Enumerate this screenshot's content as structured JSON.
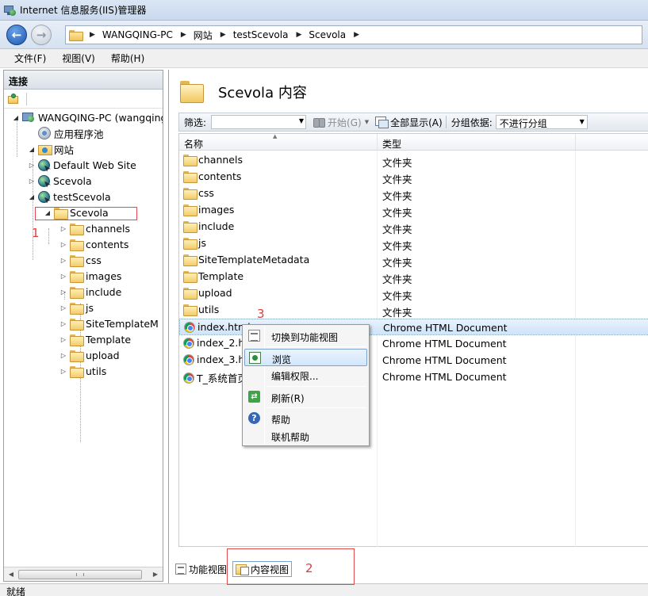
{
  "window": {
    "title": "Internet 信息服务(IIS)管理器"
  },
  "address": {
    "crumbs": [
      "WANGQING-PC",
      "网站",
      "testScevola",
      "Scevola"
    ]
  },
  "menu": {
    "items": [
      "文件(F)",
      "视图(V)",
      "帮助(H)"
    ]
  },
  "connections": {
    "header": "连接",
    "tree": [
      {
        "label": "WANGQING-PC (wangqing",
        "icon": "server-icon",
        "level": 0,
        "expander": "open"
      },
      {
        "label": "应用程序池",
        "icon": "app-pool-icon",
        "level": 1,
        "expander": "none"
      },
      {
        "label": "网站",
        "icon": "sites-icon",
        "level": 1,
        "expander": "open"
      },
      {
        "label": "Default Web Site",
        "icon": "globe-icon",
        "level": 2,
        "expander": "closed"
      },
      {
        "label": "Scevola",
        "icon": "globe-icon",
        "level": 2,
        "expander": "closed"
      },
      {
        "label": "testScevola",
        "icon": "globe-icon",
        "level": 2,
        "expander": "open"
      },
      {
        "label": "Scevola",
        "icon": "folder-icon",
        "level": 3,
        "expander": "open"
      },
      {
        "label": "channels",
        "icon": "folder-icon",
        "level": 4,
        "expander": "closed"
      },
      {
        "label": "contents",
        "icon": "folder-icon",
        "level": 4,
        "expander": "closed"
      },
      {
        "label": "css",
        "icon": "folder-icon",
        "level": 4,
        "expander": "closed"
      },
      {
        "label": "images",
        "icon": "folder-icon",
        "level": 4,
        "expander": "closed"
      },
      {
        "label": "include",
        "icon": "folder-icon",
        "level": 4,
        "expander": "closed"
      },
      {
        "label": "js",
        "icon": "folder-icon",
        "level": 4,
        "expander": "closed"
      },
      {
        "label": "SiteTemplateM",
        "icon": "folder-icon",
        "level": 4,
        "expander": "closed"
      },
      {
        "label": "Template",
        "icon": "folder-icon",
        "level": 4,
        "expander": "closed"
      },
      {
        "label": "upload",
        "icon": "folder-icon",
        "level": 4,
        "expander": "closed"
      },
      {
        "label": "utils",
        "icon": "folder-icon",
        "level": 4,
        "expander": "closed"
      }
    ]
  },
  "content": {
    "title": "Scevola 内容",
    "filter": {
      "label": "筛选:",
      "go": "开始(G)",
      "show_all": "全部显示(A)",
      "group_label": "分组依据:",
      "group_value": "不进行分组"
    },
    "columns": [
      "名称",
      "类型"
    ],
    "rows": [
      {
        "name": "channels",
        "type": "文件夹",
        "icon": "folder-icon"
      },
      {
        "name": "contents",
        "type": "文件夹",
        "icon": "folder-icon"
      },
      {
        "name": "css",
        "type": "文件夹",
        "icon": "folder-icon"
      },
      {
        "name": "images",
        "type": "文件夹",
        "icon": "folder-icon"
      },
      {
        "name": "include",
        "type": "文件夹",
        "icon": "folder-icon"
      },
      {
        "name": "js",
        "type": "文件夹",
        "icon": "folder-icon"
      },
      {
        "name": "SiteTemplateMetadata",
        "type": "文件夹",
        "icon": "folder-icon"
      },
      {
        "name": "Template",
        "type": "文件夹",
        "icon": "folder-icon"
      },
      {
        "name": "upload",
        "type": "文件夹",
        "icon": "folder-icon"
      },
      {
        "name": "utils",
        "type": "文件夹",
        "icon": "folder-icon"
      },
      {
        "name": "index.html",
        "type": "Chrome HTML Document",
        "icon": "chrome-icon",
        "selected": true
      },
      {
        "name": "index_2.ht",
        "type": "Chrome HTML Document",
        "icon": "chrome-icon"
      },
      {
        "name": "index_3.ht",
        "type": "Chrome HTML Document",
        "icon": "chrome-icon"
      },
      {
        "name": "T_系统首页",
        "type": "Chrome HTML Document",
        "icon": "chrome-icon"
      }
    ]
  },
  "context_menu": {
    "items": [
      {
        "label": "切换到功能视图",
        "icon": "feature-view-icon"
      },
      {
        "label": "浏览",
        "icon": "browse-icon",
        "highlighted": true
      },
      {
        "label": "编辑权限...",
        "icon": ""
      },
      {
        "label": "刷新(R)",
        "icon": "refresh-icon"
      },
      {
        "label": "帮助",
        "icon": "help-icon"
      },
      {
        "label": "联机帮助",
        "icon": ""
      }
    ]
  },
  "bottom_tabs": {
    "feature_view": "功能视图",
    "content_view": "内容视图"
  },
  "status": {
    "text": "就绪"
  },
  "annotations": [
    "1",
    "2",
    "3"
  ],
  "colors": {
    "annotation": "#e03c3c",
    "selection": "#cfe3f9",
    "titlebar": "#dbe6f4"
  }
}
